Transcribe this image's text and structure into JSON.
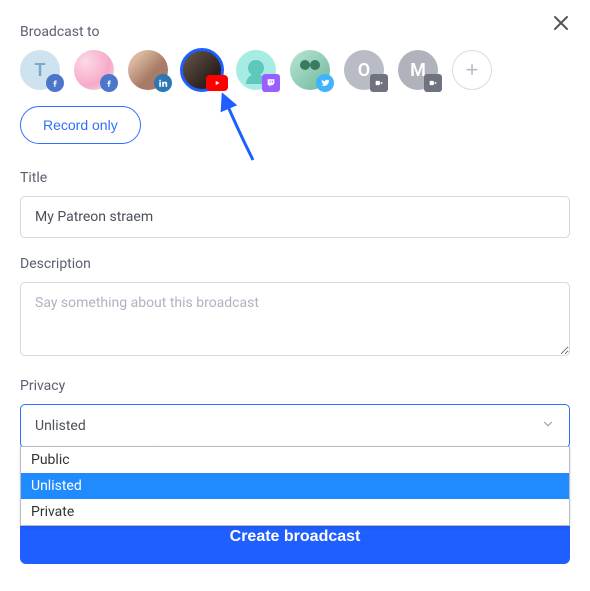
{
  "header": {
    "broadcast_to": "Broadcast to"
  },
  "channels": [
    {
      "letter": "T",
      "platform": "facebook"
    },
    {
      "letter": "",
      "platform": "facebook"
    },
    {
      "letter": "",
      "platform": "linkedin"
    },
    {
      "letter": "",
      "platform": "youtube",
      "selected": true
    },
    {
      "letter": "",
      "platform": "twitch"
    },
    {
      "letter": "",
      "platform": "twitter"
    },
    {
      "letter": "O",
      "platform": "custom"
    },
    {
      "letter": "M",
      "platform": "custom"
    }
  ],
  "record_only": "Record only",
  "title": {
    "label": "Title",
    "value": "My Patreon straem"
  },
  "description": {
    "label": "Description",
    "placeholder": "Say something about this broadcast",
    "value": ""
  },
  "privacy": {
    "label": "Privacy",
    "selected": "Unlisted",
    "options": [
      "Public",
      "Unlisted",
      "Private"
    ],
    "highlighted": "Unlisted"
  },
  "create": "Create broadcast"
}
